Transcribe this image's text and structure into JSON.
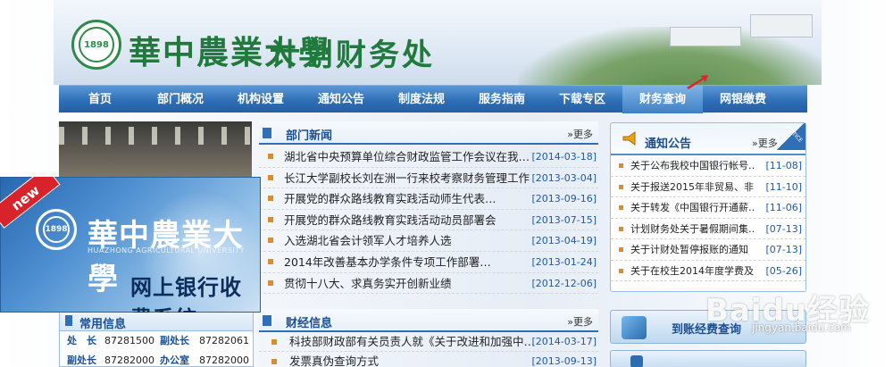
{
  "header": {
    "university": "華中農業大學",
    "department": "计划财务处",
    "logo_text": "1898"
  },
  "nav": {
    "items": [
      "首页",
      "部门概况",
      "机构设置",
      "通知公告",
      "制度法规",
      "服务指南",
      "下载专区",
      "财务查询",
      "网银缴费"
    ],
    "active": "财务查询"
  },
  "news": {
    "title": "部门新闻",
    "more": "更多",
    "items": [
      {
        "text": "湖北省中央预算单位综合财政监管工作会议在我…",
        "date": "[2014-03-18]"
      },
      {
        "text": "长江大学副校长刘在洲一行来校考察财务管理工作",
        "date": "[2013-03-04]"
      },
      {
        "text": "开展党的群众路线教育实践活动师生代表…",
        "date": "[2013-09-16]"
      },
      {
        "text": "开展党的群众路线教育实践活动动员部署会",
        "date": "[2013-07-15]"
      },
      {
        "text": "入选湖北省会计领军人才培养人选",
        "date": "[2013-04-19]"
      },
      {
        "text": "2014年改善基本办学条件专项工作部署…",
        "date": "[2013-01-24]"
      },
      {
        "text": "贯彻十八大、求真务实开创新业绩",
        "date": "[2012-12-06]"
      }
    ]
  },
  "finance": {
    "title": "财经信息",
    "more": "更多",
    "items": [
      {
        "text": "科技部财政部有关员责人就《关于改进和加强中…",
        "date": "[2014-03-17]"
      },
      {
        "text": "发票真伪查询方式",
        "date": "[2013-09-13]"
      }
    ]
  },
  "notice": {
    "title": "通知公告",
    "more": "更多",
    "tag": "NOTICE",
    "items": [
      {
        "text": "关于公布我校中国银行帐号…",
        "date": "[11-08]"
      },
      {
        "text": "关于报送2015年非贸易、非…",
        "date": "[11-10]"
      },
      {
        "text": "关于转发《中国银行开通薪…",
        "date": "[11-06]"
      },
      {
        "text": "计划财务处关于暑假期间集…",
        "date": "[07-13]"
      },
      {
        "text": "关于计财处暂停报账的通知",
        "date": "[07-13]"
      },
      {
        "text": "关于在校生2014年度学费及…",
        "date": "[05-26]"
      }
    ]
  },
  "query": {
    "label": "到账经费查询"
  },
  "common": {
    "title": "常用信息",
    "contacts": [
      {
        "k": "处　长",
        "v": "87281500"
      },
      {
        "k": "副处长",
        "v": "87282061"
      },
      {
        "k": "副处长",
        "v": "87282000"
      },
      {
        "k": "办公室",
        "v": "87282000"
      }
    ]
  },
  "ad": {
    "badge": "new",
    "name": "華中農業大學",
    "sub": "HUAZHONG AGRICULTURAL UNIVERSITY",
    "system": "网上银行收费系统"
  },
  "watermark": {
    "brand": "Baidu经验",
    "url": "jingyan.baidu.com"
  },
  "colors": {
    "nav": "#2f6fb7",
    "green": "#1f7a3c",
    "date": "#1f5aa0",
    "bullet": "#e08a2a"
  }
}
